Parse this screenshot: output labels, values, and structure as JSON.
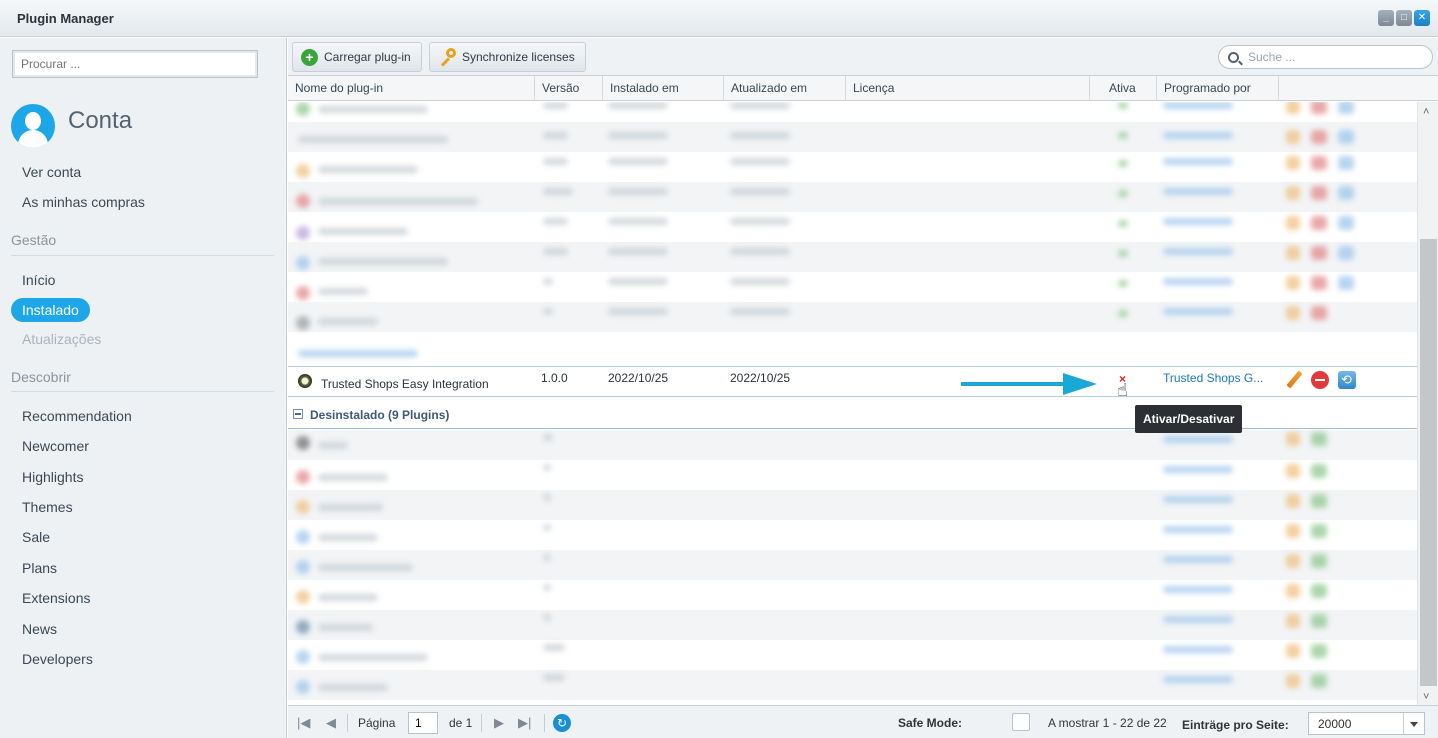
{
  "window": {
    "title": "Plugin Manager"
  },
  "sidebar": {
    "search_placeholder": "Procurar ...",
    "account_name": "Conta",
    "account_links": [
      "Ver conta",
      "As minhas compras"
    ],
    "management_title": "Gestão",
    "management_links": {
      "home": "Início",
      "installed": "Instalado",
      "updates": "Atualizações"
    },
    "discover_title": "Descobrir",
    "discover_links": [
      "Recommendation",
      "Newcomer",
      "Highlights",
      "Themes",
      "Sale",
      "Plans",
      "Extensions",
      "News",
      "Developers"
    ]
  },
  "toolbar": {
    "upload_label": "Carregar plug-in",
    "sync_label": "Synchronize licenses",
    "search_placeholder": "Suche ..."
  },
  "grid": {
    "columns": [
      "Nome do plug-in",
      "Versão",
      "Instalado em",
      "Atualizado em",
      "Licença",
      "Ativa",
      "Programado por"
    ],
    "highlight_row": {
      "name": "Trusted Shops Easy Integration",
      "version": "1.0.0",
      "installed": "2022/10/25",
      "updated": "2022/10/25",
      "license": "",
      "active_mark": "×",
      "author": "Trusted Shops G..."
    },
    "uninstalled_group_label": "Desinstalado (9 Plugins)",
    "tooltip": "Ativar/Desativar"
  },
  "footer": {
    "page_label": "Página",
    "page_value": "1",
    "of_label": "de 1",
    "safe_mode_label": "Safe Mode:",
    "showing": "A mostrar 1 - 22 de 22",
    "per_page_label": "Einträge pro Seite:",
    "per_page_value": "20000"
  },
  "colors": {
    "accent": "#1ea7e8",
    "arrow": "#1aa9d6",
    "link": "#1a78c2",
    "inactive": "#e02020"
  }
}
